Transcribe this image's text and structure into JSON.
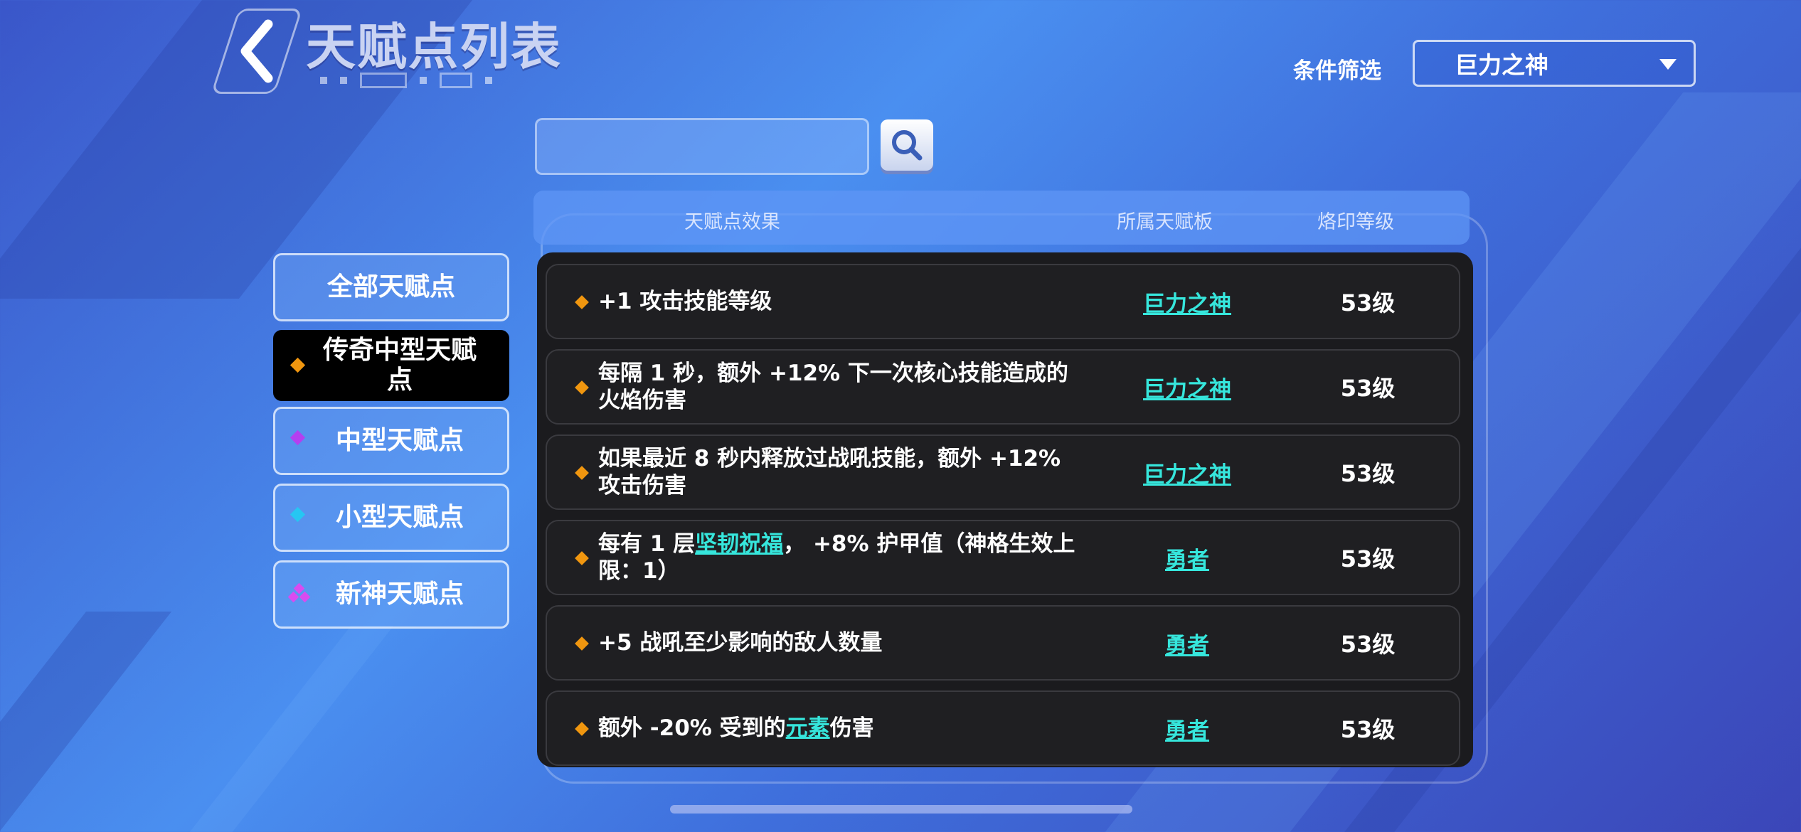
{
  "header": {
    "title": "天赋点列表",
    "filter_label": "条件筛选",
    "filter_value": "巨力之神"
  },
  "search": {
    "value": "",
    "placeholder": ""
  },
  "sidebar": {
    "items": [
      {
        "label": "全部天赋点",
        "icon": "none",
        "active": false
      },
      {
        "label": "传奇中型天赋点",
        "icon": "orange-diamond-icon",
        "active": true
      },
      {
        "label": "中型天赋点",
        "icon": "purple-diamond-icon",
        "active": false
      },
      {
        "label": "小型天赋点",
        "icon": "cyan-diamond-icon",
        "active": false
      },
      {
        "label": "新神天赋点",
        "icon": "magenta-triple-diamond-icon",
        "active": false
      }
    ]
  },
  "table": {
    "columns": [
      "天赋点效果",
      "所属天赋板",
      "烙印等级"
    ],
    "rows": [
      {
        "effect": "+1 攻击技能等级",
        "board": "巨力之神",
        "level": "53级"
      },
      {
        "effect": "每隔 1 秒，额外 +12% 下一次核心技能造成的火焰伤害",
        "board": "巨力之神",
        "level": "53级"
      },
      {
        "effect": "如果最近 8 秒内释放过战吼技能，额外 +12% 攻击伤害",
        "board": "巨力之神",
        "level": "53级"
      },
      {
        "effect_pre": "每有 1 层",
        "effect_link": "坚韧祝福",
        "effect_post": "， +8% 护甲值（神格生效上限：1）",
        "board": "勇者",
        "level": "53级"
      },
      {
        "effect": "+5 战吼至少影响的敌人数量",
        "board": "勇者",
        "level": "53级"
      },
      {
        "effect_pre": "额外 -20% 受到的",
        "effect_link": "元素",
        "effect_post": "伤害",
        "board": "勇者",
        "level": "53级"
      }
    ]
  },
  "colors": {
    "accent_link": "#36e6dc",
    "legendary": "#f0960f",
    "medium": "#b43ff0",
    "small": "#26c6f2",
    "new_god": "#d94bf0",
    "table_bg": "#1b1b1e"
  }
}
